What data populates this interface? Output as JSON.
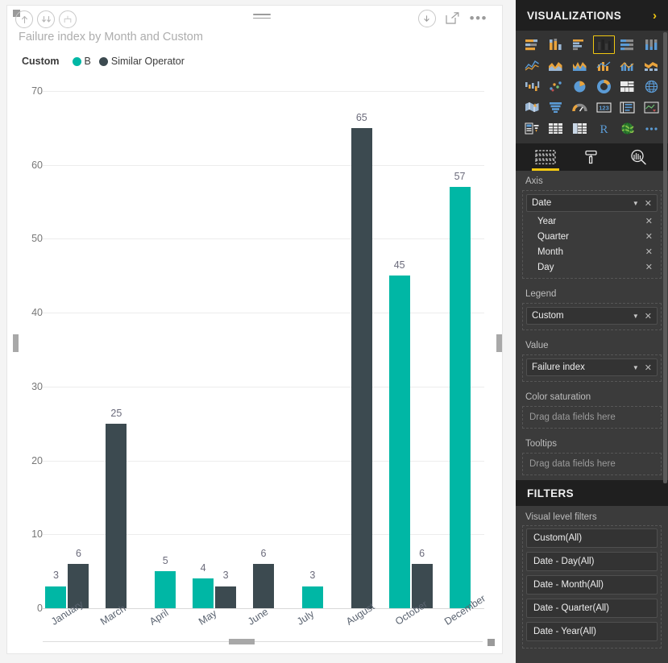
{
  "visual": {
    "title": "Failure index by Month and Custom",
    "drill_icons": [
      "drill-up-icon",
      "expand-all-icon",
      "drill-down-icon"
    ],
    "header_icons": [
      "hamburger-icon",
      "download-icon",
      "focus-mode-icon",
      "more-options-icon"
    ],
    "legend": {
      "label": "Custom",
      "items": [
        {
          "name": "B",
          "color": "#00B7A5"
        },
        {
          "name": "Similar Operator",
          "color": "#3C4A50"
        }
      ]
    }
  },
  "chart_data": {
    "type": "bar",
    "title": "Failure index by Month and Custom",
    "xlabel": "",
    "ylabel": "",
    "ylim": [
      0,
      70
    ],
    "yticks": [
      0,
      10,
      20,
      30,
      40,
      50,
      60,
      70
    ],
    "grid": true,
    "legend_position": "top-left",
    "categories": [
      "January",
      "March",
      "April",
      "May",
      "June",
      "July",
      "August",
      "October",
      "December"
    ],
    "series": [
      {
        "name": "B",
        "color": "#00B7A5",
        "values": [
          3,
          null,
          5,
          4,
          null,
          3,
          null,
          45,
          57
        ]
      },
      {
        "name": "Similar Operator",
        "color": "#3C4A50",
        "values": [
          6,
          25,
          null,
          3,
          6,
          null,
          65,
          6,
          null
        ]
      }
    ],
    "bars": [
      {
        "category": "January",
        "series": "B",
        "value": 3,
        "color": "#00B7A5"
      },
      {
        "category": "January",
        "series": "Similar Operator",
        "value": 6,
        "color": "#3C4A50"
      },
      {
        "category": "March",
        "series": "Similar Operator",
        "value": 25,
        "color": "#3C4A50"
      },
      {
        "category": "April",
        "series": "B",
        "value": 5,
        "color": "#00B7A5"
      },
      {
        "category": "May",
        "series": "B",
        "value": 4,
        "color": "#00B7A5"
      },
      {
        "category": "May",
        "series": "Similar Operator",
        "value": 3,
        "color": "#3C4A50"
      },
      {
        "category": "June",
        "series": "Similar Operator",
        "value": 6,
        "color": "#3C4A50"
      },
      {
        "category": "July",
        "series": "B",
        "value": 3,
        "color": "#00B7A5"
      },
      {
        "category": "August",
        "series": "Similar Operator",
        "value": 65,
        "color": "#3C4A50"
      },
      {
        "category": "October",
        "series": "B",
        "value": 45,
        "color": "#00B7A5"
      },
      {
        "category": "October",
        "series": "Similar Operator",
        "value": 6,
        "color": "#3C4A50"
      },
      {
        "category": "December",
        "series": "B",
        "value": 57,
        "color": "#00B7A5"
      }
    ]
  },
  "pane": {
    "title": "VISUALIZATIONS",
    "expand_icon": "chevron-right-icon",
    "viz_icons": [
      {
        "name": "stacked-bar-chart-icon",
        "selected": false
      },
      {
        "name": "stacked-column-chart-icon",
        "selected": false
      },
      {
        "name": "clustered-bar-chart-icon",
        "selected": false
      },
      {
        "name": "clustered-column-chart-icon",
        "selected": true
      },
      {
        "name": "100-stacked-bar-chart-icon",
        "selected": false
      },
      {
        "name": "100-stacked-column-chart-icon",
        "selected": false
      },
      {
        "name": "line-chart-icon",
        "selected": false
      },
      {
        "name": "area-chart-icon",
        "selected": false
      },
      {
        "name": "stacked-area-chart-icon",
        "selected": false
      },
      {
        "name": "line-and-stacked-column-chart-icon",
        "selected": false
      },
      {
        "name": "line-and-clustered-column-chart-icon",
        "selected": false
      },
      {
        "name": "ribbon-chart-icon",
        "selected": false
      },
      {
        "name": "waterfall-chart-icon",
        "selected": false
      },
      {
        "name": "scatter-chart-icon",
        "selected": false
      },
      {
        "name": "pie-chart-icon",
        "selected": false
      },
      {
        "name": "donut-chart-icon",
        "selected": false
      },
      {
        "name": "treemap-icon",
        "selected": false
      },
      {
        "name": "map-icon",
        "selected": false
      },
      {
        "name": "filled-map-icon",
        "selected": false
      },
      {
        "name": "funnel-icon",
        "selected": false
      },
      {
        "name": "gauge-icon",
        "selected": false
      },
      {
        "name": "card-icon",
        "selected": false
      },
      {
        "name": "multi-row-card-icon",
        "selected": false
      },
      {
        "name": "kpi-icon",
        "selected": false
      },
      {
        "name": "slicer-icon",
        "selected": false
      },
      {
        "name": "table-icon",
        "selected": false
      },
      {
        "name": "matrix-icon",
        "selected": false
      },
      {
        "name": "r-script-visual-icon",
        "selected": false
      },
      {
        "name": "arcgis-map-icon",
        "selected": false
      },
      {
        "name": "more-visuals-icon",
        "selected": false
      }
    ],
    "tabs": [
      {
        "name": "fields-tab",
        "icon": "fields-icon",
        "active": true
      },
      {
        "name": "format-tab",
        "icon": "paint-roller-icon",
        "active": false
      },
      {
        "name": "analytics-tab",
        "icon": "analytics-magnifier-icon",
        "active": false
      }
    ],
    "wells": [
      {
        "title": "Axis",
        "chip": "Date",
        "subfields": [
          "Year",
          "Quarter",
          "Month",
          "Day"
        ]
      },
      {
        "title": "Legend",
        "chip": "Custom",
        "subfields": []
      },
      {
        "title": "Value",
        "chip": "Failure index",
        "subfields": []
      },
      {
        "title": "Color saturation",
        "chip": null,
        "placeholder": "Drag data fields here"
      },
      {
        "title": "Tooltips",
        "chip": null,
        "placeholder": "Drag data fields here"
      }
    ]
  },
  "filters": {
    "title": "FILTERS",
    "section": "Visual level filters",
    "items": [
      "Custom(All)",
      "Date - Day(All)",
      "Date - Month(All)",
      "Date - Quarter(All)",
      "Date - Year(All)"
    ]
  }
}
